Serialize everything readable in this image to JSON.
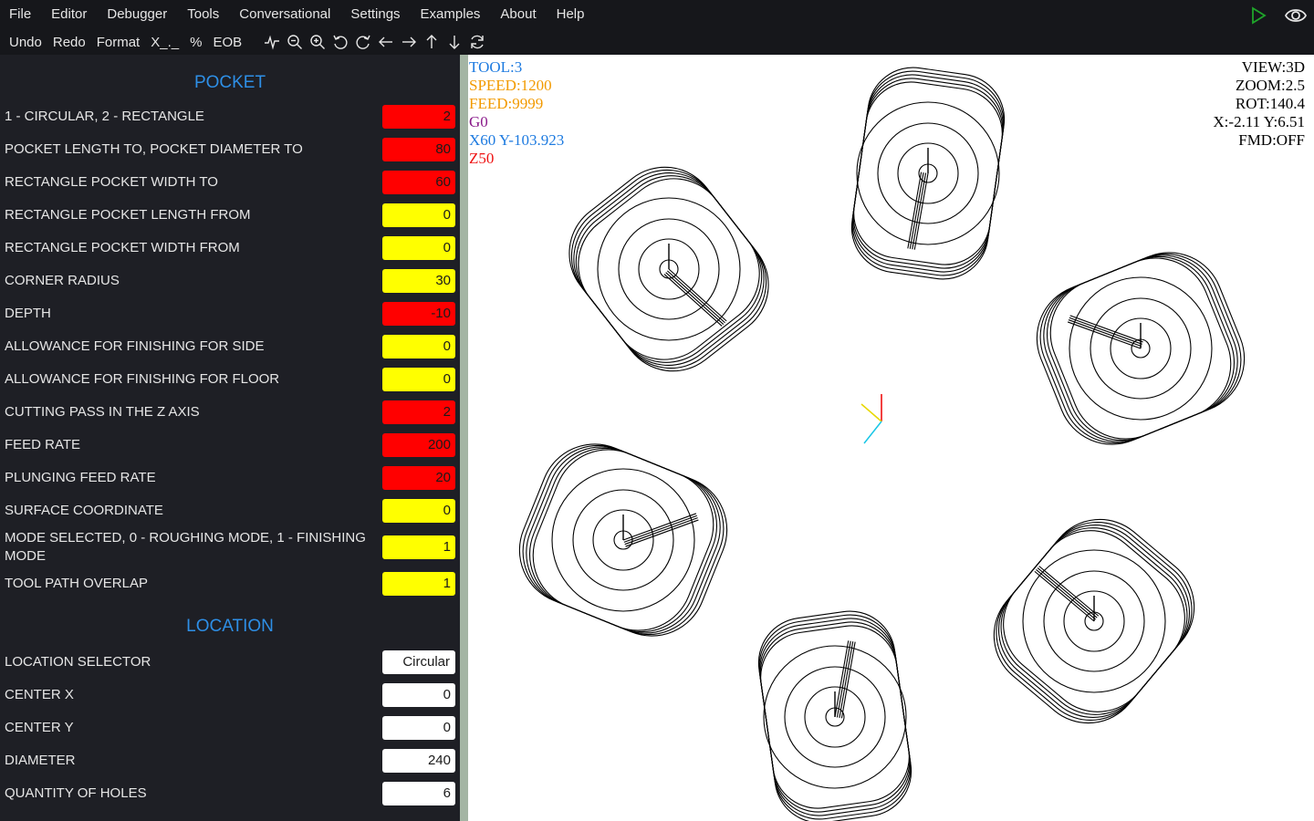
{
  "menu": [
    "File",
    "Editor",
    "Debugger",
    "Tools",
    "Conversational",
    "Settings",
    "Examples",
    "About",
    "Help"
  ],
  "toolbar": {
    "buttons": [
      "Undo",
      "Redo",
      "Format",
      "X_._",
      "%",
      "EOB"
    ],
    "icons": [
      "waveform-icon",
      "zoom-out-icon",
      "zoom-in-icon",
      "rotate-left-icon",
      "rotate-right-icon",
      "arrow-left-icon",
      "arrow-right-icon",
      "arrow-up-icon",
      "arrow-down-icon",
      "refresh-icon"
    ]
  },
  "topright_icons": [
    "play-icon",
    "eye-icon"
  ],
  "colors": {
    "play": "#1fa52a",
    "section_title": "#2e8fe6",
    "red_field": "#ff0000",
    "yellow_field": "#ffff00",
    "splitter": "#a4b5a4"
  },
  "pocket": {
    "title": "POCKET",
    "fields": [
      {
        "label": "1 - CIRCULAR, 2 - RECTANGLE",
        "value": "2",
        "color": "red"
      },
      {
        "label": "POCKET LENGTH TO, POCKET DIAMETER TO",
        "value": "80",
        "color": "red"
      },
      {
        "label": "RECTANGLE POCKET WIDTH TO",
        "value": "60",
        "color": "red"
      },
      {
        "label": "RECTANGLE POCKET LENGTH FROM",
        "value": "0",
        "color": "yellow"
      },
      {
        "label": "RECTANGLE POCKET WIDTH FROM",
        "value": "0",
        "color": "yellow"
      },
      {
        "label": "CORNER RADIUS",
        "value": "30",
        "color": "yellow"
      },
      {
        "label": "DEPTH",
        "value": "-10",
        "color": "red"
      },
      {
        "label": "ALLOWANCE FOR FINISHING FOR SIDE",
        "value": "0",
        "color": "yellow"
      },
      {
        "label": "ALLOWANCE FOR FINISHING FOR FLOOR",
        "value": "0",
        "color": "yellow"
      },
      {
        "label": "CUTTING PASS IN THE Z AXIS",
        "value": "2",
        "color": "red"
      },
      {
        "label": "FEED RATE",
        "value": "200",
        "color": "red"
      },
      {
        "label": "PLUNGING FEED RATE",
        "value": "20",
        "color": "red"
      },
      {
        "label": "SURFACE COORDINATE",
        "value": "0",
        "color": "yellow"
      },
      {
        "label": "MODE SELECTED, 0 - ROUGHING MODE, 1 - FINISHING MODE",
        "value": "1",
        "color": "yellow"
      },
      {
        "label": "TOOL PATH OVERLAP",
        "value": "1",
        "color": "yellow"
      }
    ]
  },
  "location": {
    "title": "LOCATION",
    "fields": [
      {
        "label": "LOCATION SELECTOR",
        "value": "Circular",
        "color": "select"
      },
      {
        "label": "CENTER X",
        "value": "0",
        "color": "white"
      },
      {
        "label": "CENTER Y",
        "value": "0",
        "color": "white"
      },
      {
        "label": "DIAMETER",
        "value": "240",
        "color": "white"
      },
      {
        "label": "QUANTITY OF HOLES",
        "value": "6",
        "color": "white"
      }
    ]
  },
  "hud_left": [
    {
      "text": "TOOL:3",
      "color": "#1e7be0"
    },
    {
      "text": "SPEED:1200",
      "color": "#f29a00"
    },
    {
      "text": "FEED:9999",
      "color": "#f29a00"
    },
    {
      "text": "G0",
      "color": "#8a1a8a"
    },
    {
      "text": "X60 Y-103.923",
      "color": "#1e7be0"
    },
    {
      "text": "Z50",
      "color": "#ee1111"
    }
  ],
  "hud_right": [
    "VIEW:3D",
    "ZOOM:2.5",
    "ROT:140.4",
    "X:-2.11 Y:6.51",
    "FMD:OFF"
  ]
}
